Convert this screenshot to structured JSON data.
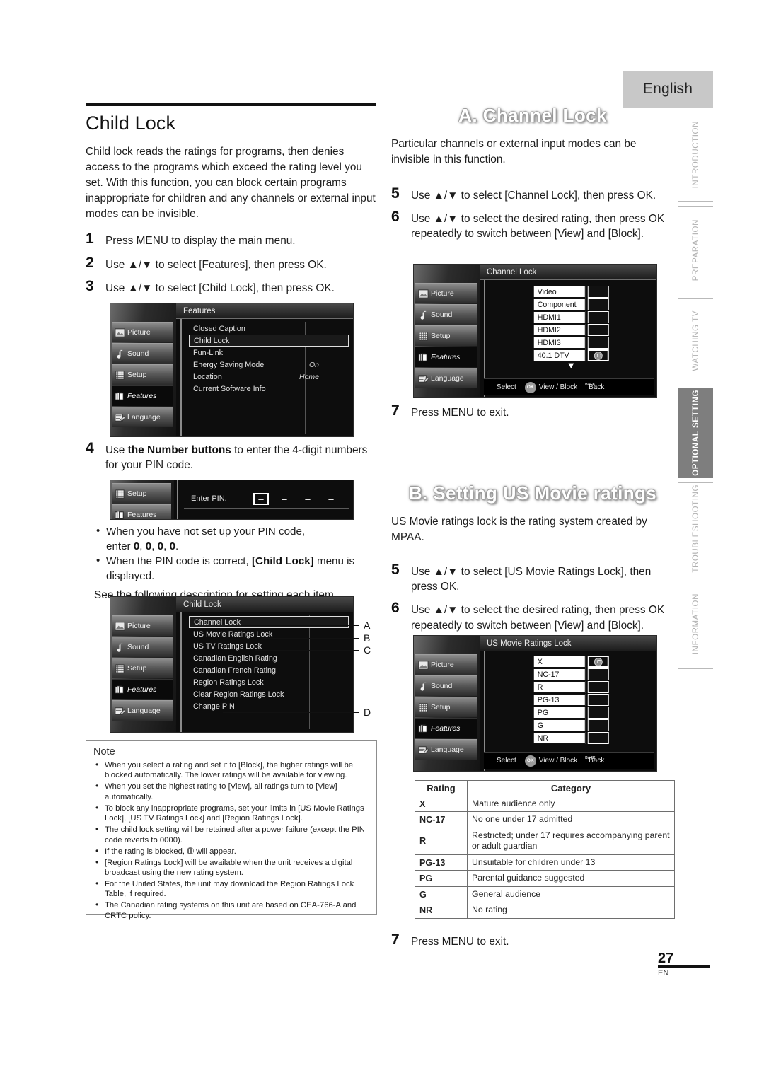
{
  "language_tab": "English",
  "side_tabs": [
    {
      "label": "INTRODUCTION",
      "active": false
    },
    {
      "label": "PREPARATION",
      "active": false
    },
    {
      "label": "WATCHING TV",
      "active": false
    },
    {
      "label": "OPTIONAL SETTING",
      "active": true
    },
    {
      "label": "TROUBLESHOOTING",
      "active": false
    },
    {
      "label": "INFORMATION",
      "active": false
    }
  ],
  "left": {
    "title": "Child Lock",
    "intro": "Child lock reads the ratings for programs, then denies access to the programs which exceed the rating level you set. With this function, you can block certain programs inappropriate for children and any channels or external input modes can be invisible.",
    "steps": [
      {
        "num": "1",
        "text": "Press MENU to display the main menu."
      },
      {
        "num": "2",
        "text": "Use ▲/▼ to select [Features], then press OK."
      },
      {
        "num": "3",
        "text": "Use ▲/▼ to select [Child Lock], then press OK."
      },
      {
        "num": "4",
        "text": "Use the Number buttons to enter the 4-digit numbers for your PIN code."
      }
    ],
    "pin_bullets": [
      "When you have not set up your PIN code, enter 0, 0, 0, 0.",
      "When the PIN code is correct, [Child Lock] menu is displayed."
    ],
    "see_following": "See the following description for setting each item."
  },
  "features_menu": {
    "title": "Features",
    "sidebar": [
      "Picture",
      "Sound",
      "Setup",
      "Features",
      "Language"
    ],
    "selected_sidebar": "Features",
    "rows": [
      {
        "label": "Closed Caption",
        "value": "",
        "highlighted": false
      },
      {
        "label": "Child Lock",
        "value": "",
        "highlighted": true
      },
      {
        "label": "Fun-Link",
        "value": "",
        "highlighted": false
      },
      {
        "label": "Energy Saving Mode",
        "value": "On",
        "highlighted": false
      },
      {
        "label": "Location",
        "value": "Home",
        "highlighted": false
      },
      {
        "label": "Current Software Info",
        "value": "",
        "highlighted": false
      }
    ]
  },
  "pin_menu": {
    "sidebar": [
      "Setup",
      "Features"
    ],
    "prompt": "Enter PIN.",
    "digits": [
      "–",
      "–",
      "–",
      "–"
    ]
  },
  "childlock_menu": {
    "title": "Child Lock",
    "sidebar": [
      "Picture",
      "Sound",
      "Setup",
      "Features",
      "Language"
    ],
    "selected_sidebar": "Features",
    "rows": [
      {
        "label": "Channel Lock",
        "highlighted": true,
        "callout": "A"
      },
      {
        "label": "US Movie Ratings Lock",
        "highlighted": false,
        "callout": "B"
      },
      {
        "label": "US TV Ratings Lock",
        "highlighted": false,
        "callout": "C"
      },
      {
        "label": "Canadian English Rating",
        "highlighted": false,
        "callout": ""
      },
      {
        "label": "Canadian French Rating",
        "highlighted": false,
        "callout": ""
      },
      {
        "label": "Region Ratings Lock",
        "highlighted": false,
        "callout": ""
      },
      {
        "label": "Clear Region Ratings Lock",
        "highlighted": false,
        "callout": ""
      },
      {
        "label": "Change PIN",
        "highlighted": false,
        "callout": "D"
      }
    ]
  },
  "note": {
    "title": "Note",
    "items": [
      "When you select a rating and set it to [Block], the higher ratings will be blocked automatically. The lower ratings will be available for viewing.",
      "When you set the highest rating to [View], all ratings turn to [View] automatically.",
      "To block any inappropriate programs, set your limits in [US Movie Ratings Lock], [US TV Ratings Lock] and [Region Ratings Lock].",
      "The child lock setting will be retained after a power failure (except the PIN code reverts to 0000).",
      "If the rating is blocked, ⬤ will appear.",
      "[Region Ratings Lock] will be available when the unit receives a digital broadcast using the new rating system.",
      "For the United States, the unit may download the Region Ratings Lock Table, if required.",
      "The Canadian rating systems on this unit are based on CEA-766-A and CRTC policy."
    ]
  },
  "section_a": {
    "banner": "A. Channel Lock",
    "intro": "Particular channels or external input modes can be invisible in this function.",
    "steps": [
      {
        "num": "5",
        "text": "Use ▲/▼ to select [Channel Lock], then press OK."
      },
      {
        "num": "6",
        "text": "Use ▲/▼ to select the desired rating, then press OK repeatedly to switch between [View] and [Block]."
      },
      {
        "num": "7",
        "text": "Press MENU to exit."
      }
    ]
  },
  "channel_lock_menu": {
    "title": "Channel Lock",
    "sidebar": [
      "Picture",
      "Sound",
      "Setup",
      "Features",
      "Language"
    ],
    "selected_sidebar": "Features",
    "items": [
      {
        "name": "Video",
        "locked": false,
        "selected": false
      },
      {
        "name": "Component",
        "locked": false,
        "selected": false
      },
      {
        "name": "HDMI1",
        "locked": false,
        "selected": false
      },
      {
        "name": "HDMI2",
        "locked": false,
        "selected": false
      },
      {
        "name": "HDMI3",
        "locked": false,
        "selected": false
      },
      {
        "name": "40.1 DTV",
        "locked": true,
        "selected": true
      }
    ],
    "footer": [
      {
        "icon": "dpad-icon",
        "label": "Select"
      },
      {
        "icon": "ok-button-icon",
        "label": "View / Block"
      },
      {
        "icon": "back-button-icon",
        "label": "Back"
      }
    ]
  },
  "section_b": {
    "banner": "B. Setting US Movie ratings",
    "intro": "US Movie ratings lock is the rating system created by MPAA.",
    "steps": [
      {
        "num": "5",
        "text": "Use ▲/▼ to select [US Movie Ratings Lock], then press OK."
      },
      {
        "num": "6",
        "text": "Use ▲/▼ to select the desired rating, then press OK repeatedly to switch between [View] and [Block]."
      },
      {
        "num": "7",
        "text": "Press MENU to exit."
      }
    ]
  },
  "movie_ratings_menu": {
    "title": "US Movie Ratings Lock",
    "sidebar": [
      "Picture",
      "Sound",
      "Setup",
      "Features",
      "Language"
    ],
    "selected_sidebar": "Features",
    "items": [
      {
        "name": "X",
        "locked": true,
        "selected": true
      },
      {
        "name": "NC-17",
        "locked": false,
        "selected": false
      },
      {
        "name": "R",
        "locked": false,
        "selected": false
      },
      {
        "name": "PG-13",
        "locked": false,
        "selected": false
      },
      {
        "name": "PG",
        "locked": false,
        "selected": false
      },
      {
        "name": "G",
        "locked": false,
        "selected": false
      },
      {
        "name": "NR",
        "locked": false,
        "selected": false
      }
    ],
    "footer": [
      {
        "icon": "dpad-icon",
        "label": "Select"
      },
      {
        "icon": "ok-button-icon",
        "label": "View / Block"
      },
      {
        "icon": "back-button-icon",
        "label": "Back"
      }
    ]
  },
  "ratings_table": {
    "headers": [
      "Rating",
      "Category"
    ],
    "rows": [
      {
        "rating": "X",
        "category": "Mature audience only"
      },
      {
        "rating": "NC-17",
        "category": "No one under 17 admitted"
      },
      {
        "rating": "R",
        "category": "Restricted; under 17 requires accompanying parent or adult guardian"
      },
      {
        "rating": "PG-13",
        "category": "Unsuitable for children under 13"
      },
      {
        "rating": "PG",
        "category": "Parental guidance suggested"
      },
      {
        "rating": "G",
        "category": "General audience"
      },
      {
        "rating": "NR",
        "category": "No rating"
      }
    ]
  },
  "footer": {
    "page_number": "27",
    "locale_code": "EN"
  }
}
